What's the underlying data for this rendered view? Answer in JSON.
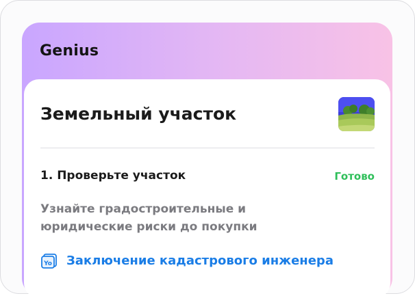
{
  "brand": {
    "name": "Genius"
  },
  "card": {
    "title": "Земельный участок",
    "thumbnail_icon": "land-plot-photo"
  },
  "step": {
    "title": "1. Проверьте участок",
    "status": "Готово",
    "status_color": "#2fbf5a",
    "description_line1": "Узнайте градостроительные и",
    "description_line2": "юридические риски до покупки"
  },
  "link": {
    "icon": "document-yo-icon",
    "icon_text": "Yo",
    "label": "Заключение кадастрового инженера",
    "color": "#1a7de6"
  },
  "colors": {
    "gradient_start": "#c9a6ff",
    "gradient_end": "#f8c2e6"
  }
}
